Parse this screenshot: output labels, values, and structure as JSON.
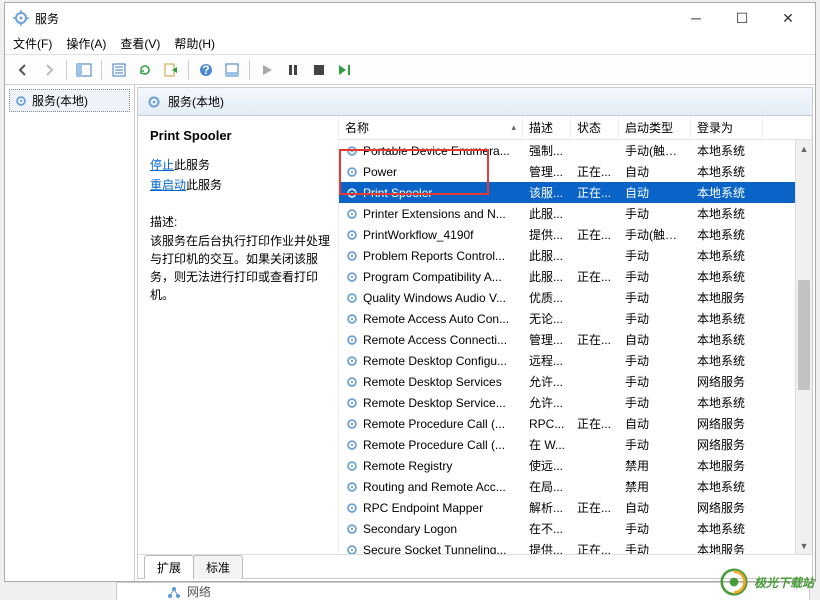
{
  "window": {
    "title": "服务"
  },
  "menu": {
    "file": "文件(F)",
    "action": "操作(A)",
    "view": "查看(V)",
    "help": "帮助(H)"
  },
  "tree": {
    "root": "服务(本地)"
  },
  "panel": {
    "header": "服务(本地)"
  },
  "detail": {
    "title": "Print Spooler",
    "stop_link": "停止",
    "stop_suffix": "此服务",
    "restart_link": "重启动",
    "restart_suffix": "此服务",
    "desc_label": "描述:",
    "desc_text": "该服务在后台执行打印作业并处理与打印机的交互。如果关闭该服务，则无法进行打印或查看打印机。"
  },
  "columns": {
    "name": "名称",
    "desc": "描述",
    "status": "状态",
    "startup": "启动类型",
    "logon": "登录为"
  },
  "tabs": {
    "ext": "扩展",
    "std": "标准"
  },
  "watermark": "极光下载站",
  "bottom_label": "网络",
  "services": [
    {
      "name": "Portable Device Enumera...",
      "desc": "强制...",
      "status": "",
      "startup": "手动(触发...",
      "logon": "本地系统"
    },
    {
      "name": "Power",
      "desc": "管理...",
      "status": "正在...",
      "startup": "自动",
      "logon": "本地系统"
    },
    {
      "name": "Print Spooler",
      "desc": "该服...",
      "status": "正在...",
      "startup": "自动",
      "logon": "本地系统",
      "selected": true
    },
    {
      "name": "Printer Extensions and N...",
      "desc": "此服...",
      "status": "",
      "startup": "手动",
      "logon": "本地系统"
    },
    {
      "name": "PrintWorkflow_4190f",
      "desc": "提供...",
      "status": "正在...",
      "startup": "手动(触发...",
      "logon": "本地系统"
    },
    {
      "name": "Problem Reports Control...",
      "desc": "此服...",
      "status": "",
      "startup": "手动",
      "logon": "本地系统"
    },
    {
      "name": "Program Compatibility A...",
      "desc": "此服...",
      "status": "正在...",
      "startup": "手动",
      "logon": "本地系统"
    },
    {
      "name": "Quality Windows Audio V...",
      "desc": "优质...",
      "status": "",
      "startup": "手动",
      "logon": "本地服务"
    },
    {
      "name": "Remote Access Auto Con...",
      "desc": "无论...",
      "status": "",
      "startup": "手动",
      "logon": "本地系统"
    },
    {
      "name": "Remote Access Connecti...",
      "desc": "管理...",
      "status": "正在...",
      "startup": "自动",
      "logon": "本地系统"
    },
    {
      "name": "Remote Desktop Configu...",
      "desc": "远程...",
      "status": "",
      "startup": "手动",
      "logon": "本地系统"
    },
    {
      "name": "Remote Desktop Services",
      "desc": "允许...",
      "status": "",
      "startup": "手动",
      "logon": "网络服务"
    },
    {
      "name": "Remote Desktop Service...",
      "desc": "允许...",
      "status": "",
      "startup": "手动",
      "logon": "本地系统"
    },
    {
      "name": "Remote Procedure Call (...",
      "desc": "RPC...",
      "status": "正在...",
      "startup": "自动",
      "logon": "网络服务"
    },
    {
      "name": "Remote Procedure Call (...",
      "desc": "在 W...",
      "status": "",
      "startup": "手动",
      "logon": "网络服务"
    },
    {
      "name": "Remote Registry",
      "desc": "使远...",
      "status": "",
      "startup": "禁用",
      "logon": "本地服务"
    },
    {
      "name": "Routing and Remote Acc...",
      "desc": "在局...",
      "status": "",
      "startup": "禁用",
      "logon": "本地系统"
    },
    {
      "name": "RPC Endpoint Mapper",
      "desc": "解析...",
      "status": "正在...",
      "startup": "自动",
      "logon": "网络服务"
    },
    {
      "name": "Secondary Logon",
      "desc": "在不...",
      "status": "",
      "startup": "手动",
      "logon": "本地系统"
    },
    {
      "name": "Secure Socket Tunneling...",
      "desc": "提供...",
      "status": "正在...",
      "startup": "手动",
      "logon": "本地服务"
    }
  ]
}
